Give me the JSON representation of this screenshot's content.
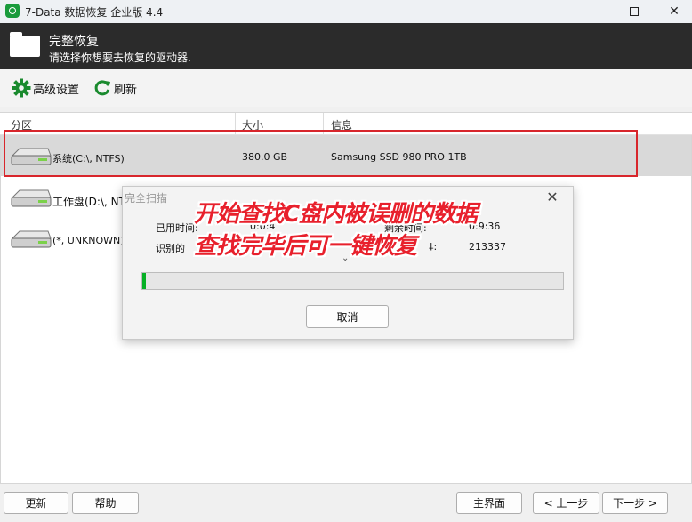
{
  "window": {
    "title": "7-Data 数据恢复 企业版 4.4",
    "minimize_glyph": "—",
    "close_glyph": "✕"
  },
  "header": {
    "title": "完整恢复",
    "subtitle": "请选择你想要去恢复的驱动器."
  },
  "toolbar": {
    "advanced_label": "高级设置",
    "refresh_label": "刷新"
  },
  "table": {
    "columns": [
      "分区",
      "大小",
      "信息"
    ],
    "rows": [
      {
        "name": "系统(C:\\, NTFS)",
        "size": "380.0 GB",
        "info": "Samsung SSD 980 PRO 1TB"
      },
      {
        "name": "工作盘(D:\\, NT",
        "size": "",
        "info": ""
      },
      {
        "name": "(*, UNKNOWN)",
        "size": "",
        "info": ""
      }
    ]
  },
  "dialog": {
    "title": "完全扫描",
    "close_glyph": "✕",
    "elapsed_label": "已用时间:",
    "elapsed_value": "0:0:4",
    "remaining_label": "剩余时间:",
    "remaining_value": "0:9:36",
    "identified_label": "识别的",
    "count_label_fragment": "‡:",
    "count_value": "213337",
    "expand_glyph": "⌄",
    "progress_fraction": 0.007,
    "cancel_label": "取消"
  },
  "overlay": {
    "line1": "开始查找C盘内被误删的数据",
    "line2": "查找完毕后可一键恢复"
  },
  "footer": {
    "update_label": "更新",
    "help_label": "帮助",
    "home_label": "主界面",
    "prev_label": "< 上一步",
    "next_label": "下一步 >"
  },
  "colors": {
    "accent_green": "#06b025",
    "highlight_red": "#d8262c",
    "header_bg": "#2b2b2b"
  }
}
